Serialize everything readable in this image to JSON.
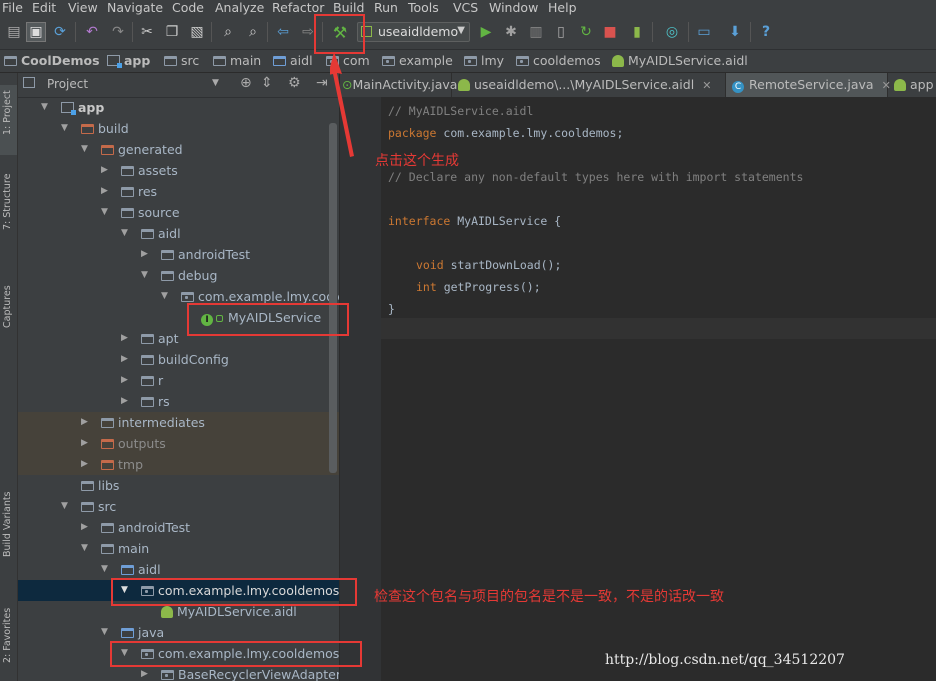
{
  "menu": [
    "File",
    "Edit",
    "View",
    "Navigate",
    "Code",
    "Analyze",
    "Refactor",
    "Build",
    "Run",
    "Tools",
    "VCS",
    "Window",
    "Help"
  ],
  "toolbar": {
    "run_config": "useaidldemo"
  },
  "breadcrumb": [
    "CoolDemos",
    "app",
    "src",
    "main",
    "aidl",
    "com",
    "example",
    "lmy",
    "cooldemos",
    "MyAIDLService.aidl"
  ],
  "project_panel": {
    "title": "Project",
    "rows": [
      {
        "label": "app"
      },
      {
        "label": "build"
      },
      {
        "label": "generated"
      },
      {
        "label": "assets"
      },
      {
        "label": "res"
      },
      {
        "label": "source"
      },
      {
        "label": "aidl"
      },
      {
        "label": "androidTest"
      },
      {
        "label": "debug"
      },
      {
        "label": "com.example.lmy.cooldemos"
      },
      {
        "label": "MyAIDLService"
      },
      {
        "label": "apt"
      },
      {
        "label": "buildConfig"
      },
      {
        "label": "r"
      },
      {
        "label": "rs"
      },
      {
        "label": "intermediates"
      },
      {
        "label": "outputs"
      },
      {
        "label": "tmp"
      },
      {
        "label": "libs"
      },
      {
        "label": "src"
      },
      {
        "label": "androidTest"
      },
      {
        "label": "main"
      },
      {
        "label": "aidl"
      },
      {
        "label": "com.example.lmy.cooldemos"
      },
      {
        "label": "MyAIDLService.aidl"
      },
      {
        "label": "java"
      },
      {
        "label": "com.example.lmy.cooldemos"
      },
      {
        "label": "BaseRecyclerViewAdapterHelper"
      }
    ]
  },
  "side_tabs": {
    "project": "1: Project",
    "structure": "7: Structure",
    "captures": "Captures",
    "build_variants": "Build Variants",
    "favorites": "2: Favorites"
  },
  "editor_tabs": [
    "MainActivity.java",
    "useaidldemo\\...\\MyAIDLService.aidl",
    "RemoteService.java",
    "app"
  ],
  "code": {
    "l1": "// MyAIDLService.aidl",
    "l2_kw": "package",
    "l2_rest": " com.example.lmy.cooldemos;",
    "l3": "// Declare any non-default types here with import statements",
    "l4_kw": "interface",
    "l4_rest": " MyAIDLService {",
    "l5_kw": "void",
    "l5_rest": " startDownLoad();",
    "l6_kw": "int",
    "l6_rest": " getProgress();",
    "l7": "}"
  },
  "annotations": {
    "generate": "点击这个生成",
    "check_package": "检查这个包名与项目的包名是不是一致，不是的话改一致"
  },
  "watermark": "http://blog.csdn.net/qq_34512207",
  "colors": {
    "annotation_red": "#e53935",
    "keyword": "#cc7832",
    "comment": "#808080"
  }
}
